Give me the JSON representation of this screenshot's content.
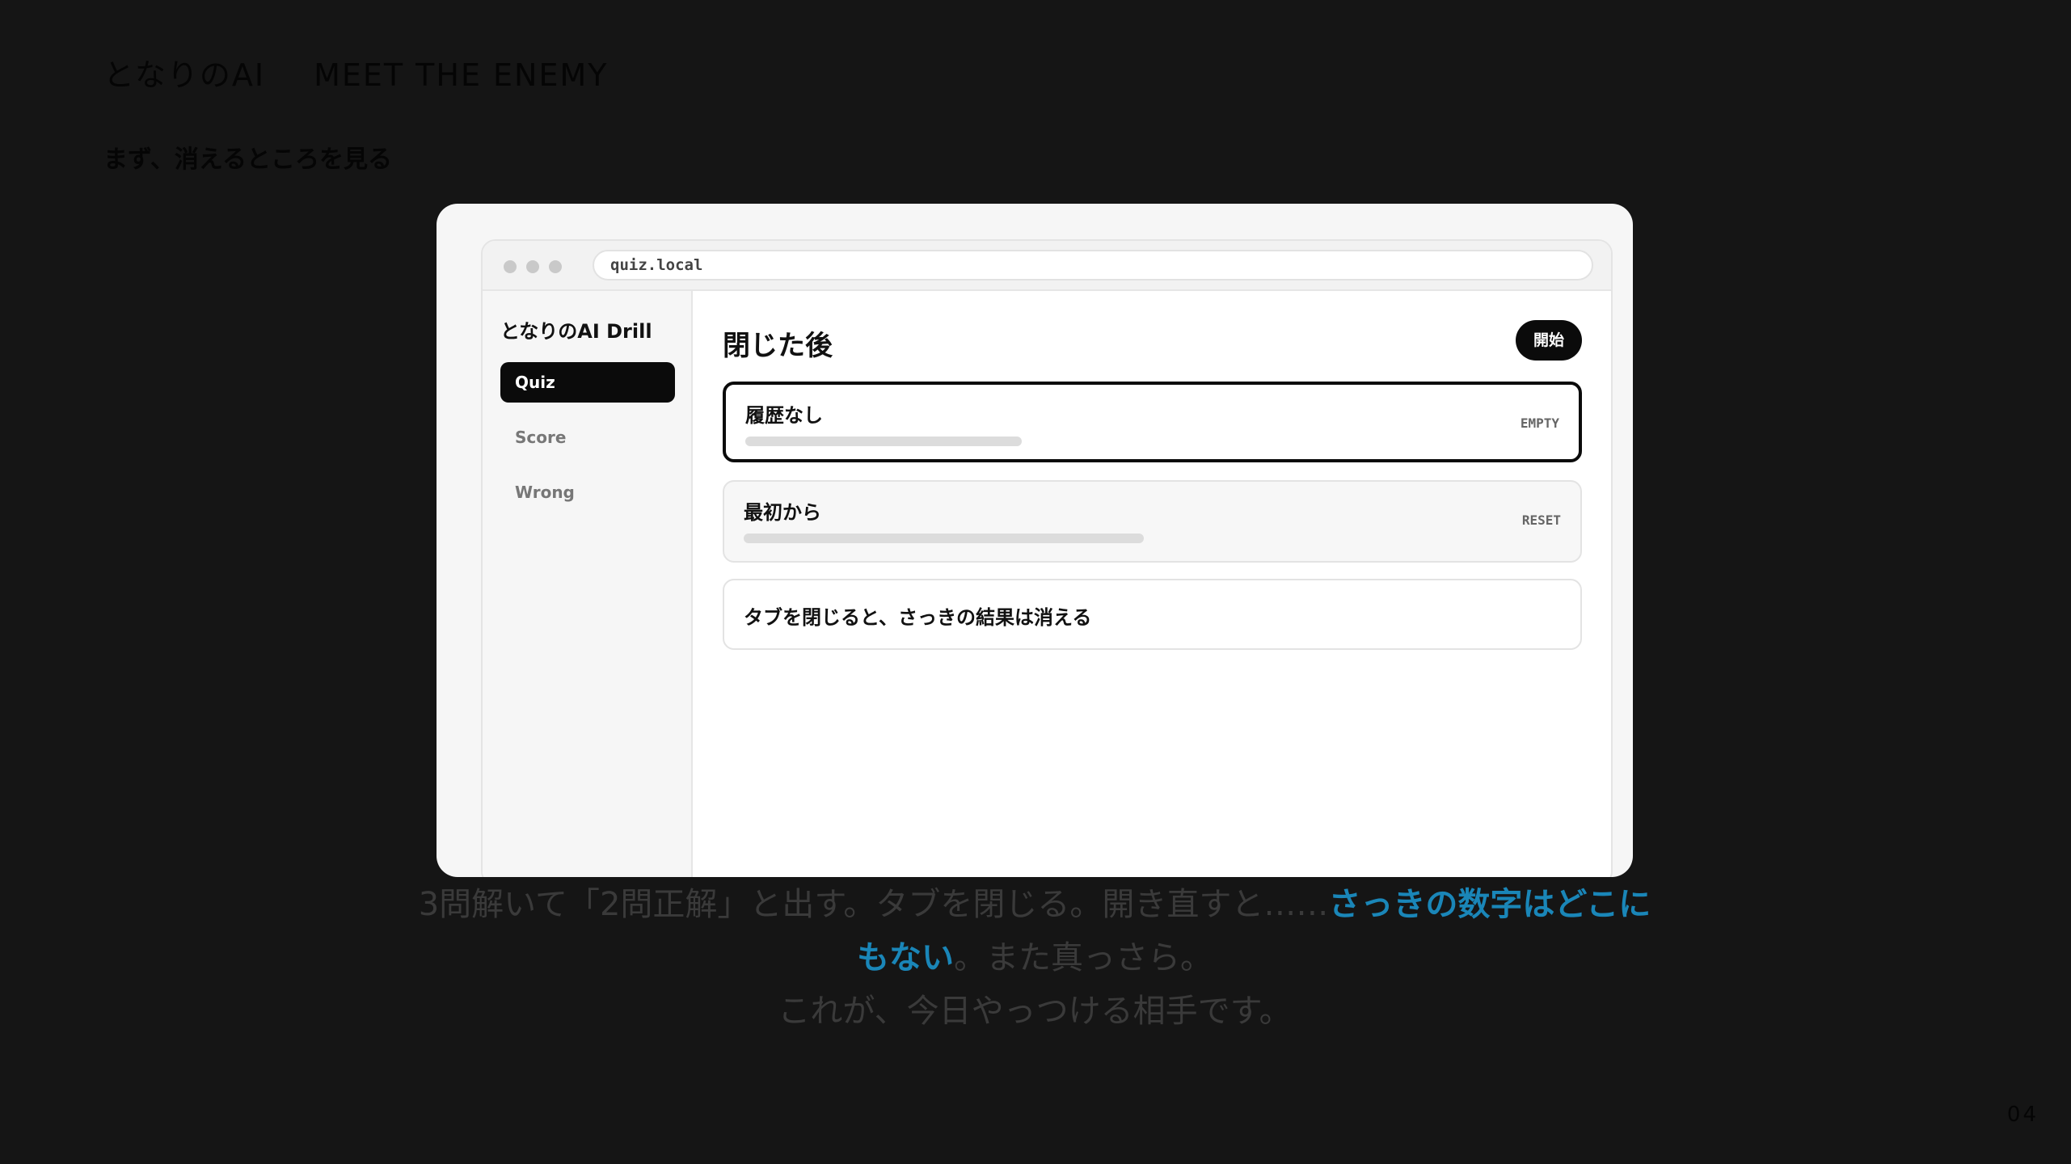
{
  "slide": {
    "brand": "となりのAI",
    "section": "MEET THE ENEMY",
    "subheading": "まず、消えるところを見る",
    "page_number": "04"
  },
  "browser": {
    "url": "quiz.local"
  },
  "app": {
    "title": "となりのAI Drill",
    "nav": [
      {
        "label": "Quiz",
        "active": true
      },
      {
        "label": "Score",
        "active": false
      },
      {
        "label": "Wrong",
        "active": false
      }
    ],
    "main": {
      "title": "閉じた後",
      "start_button": "開始",
      "items": [
        {
          "label": "履歴なし",
          "tag": "EMPTY",
          "progress": 0.34
        },
        {
          "label": "最初から",
          "tag": "RESET",
          "progress": 0.49
        },
        {
          "label": "タブを閉じると、さっきの結果は消える"
        }
      ]
    }
  },
  "caption": {
    "line1_normal": "3問解いて「2問正解」と出す。タブを閉じる。開き直すと……",
    "highlight": "さっきの数字はどこにもない",
    "line2_normal": "。また真っさら。",
    "line3": "これが、今日やっつける相手です。"
  },
  "colors": {
    "background": "#151515",
    "highlight": "#1a86b8",
    "active_nav": "#0b0b0b"
  }
}
